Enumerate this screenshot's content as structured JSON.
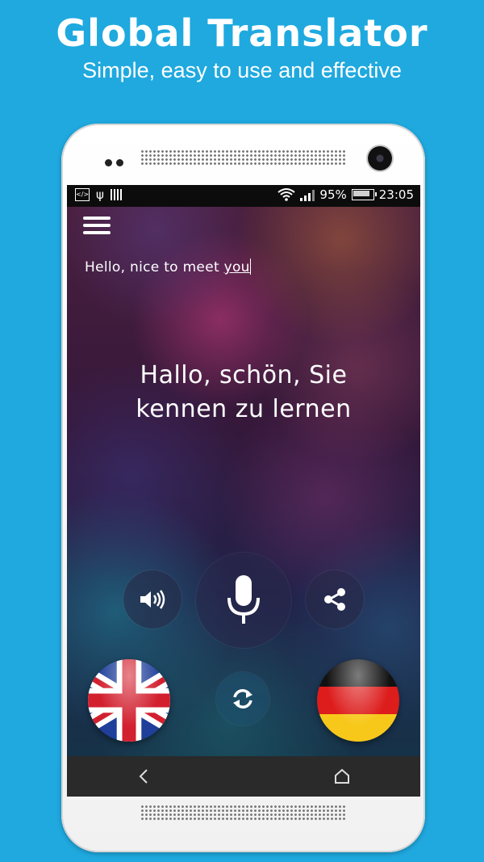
{
  "promo": {
    "title": "Global Translator",
    "subtitle": "Simple, easy to use and effective"
  },
  "status_bar": {
    "battery_percent": "95%",
    "time": "23:05",
    "icons": [
      "code-icon",
      "usb-icon",
      "barcode-icon",
      "wifi-icon",
      "signal-icon",
      "battery-icon"
    ]
  },
  "app": {
    "menu_icon": "hamburger-menu-icon",
    "source_text_main": "Hello, nice to meet ",
    "source_text_underlined": "you",
    "translated_text": "Hallo, schön, Sie kennen zu lernen",
    "buttons": {
      "speaker": "speaker-icon",
      "microphone": "microphone-icon",
      "share": "share-icon",
      "swap": "swap-languages-icon"
    },
    "source_language_flag": "uk-flag",
    "target_language_flag": "germany-flag"
  },
  "nav": {
    "back": "back-icon",
    "home": "home-icon"
  },
  "colors": {
    "background": "#1fa9df",
    "nav_bar": "#2a2a2a",
    "status_bar": "#0c0c0c"
  }
}
